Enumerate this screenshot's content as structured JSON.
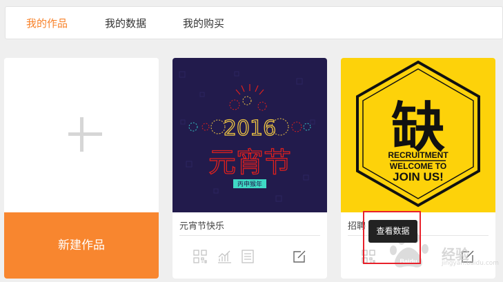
{
  "tabs": [
    {
      "label": "我的作品",
      "active": true
    },
    {
      "label": "我的数据",
      "active": false
    },
    {
      "label": "我的购买",
      "active": false
    }
  ],
  "new_card": {
    "label": "新建作品"
  },
  "cards": [
    {
      "title": "元宵节快乐",
      "cover": {
        "year": "2016",
        "heading": "元宵节",
        "banner": "丙申猴年",
        "background": "#221b4c",
        "accent": "#e0201d",
        "gold": "#f1c743"
      },
      "actions": [
        "qrcode-icon",
        "stats-icon",
        "list-icon",
        "edit-icon"
      ]
    },
    {
      "title": "招聘",
      "cover": {
        "big_char": "缺",
        "line1": "RECRUITMENT",
        "line2": "WELCOME TO",
        "line3": "JOIN US!",
        "background": "#fdd20a",
        "ink": "#111111"
      },
      "actions": [
        "qrcode-icon",
        "stats-icon",
        "list-icon",
        "edit-icon"
      ]
    }
  ],
  "tooltip": {
    "label": "查看数据"
  },
  "watermark": {
    "text": "经验",
    "brand": "Baidu",
    "sub": "jingyan.baidu.com"
  },
  "colors": {
    "accent": "#f8822a",
    "new_button": "#f8862f",
    "highlight": "#e8202a"
  }
}
